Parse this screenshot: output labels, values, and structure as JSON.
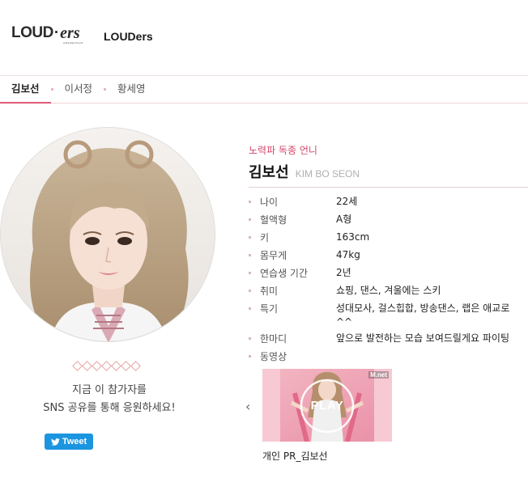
{
  "header": {
    "logo_main": "LOUD",
    "logo_dot": "·",
    "logo_ers": "ers",
    "logo_sub": "entertainment",
    "company_name": "LOUDers"
  },
  "tabs": [
    {
      "label": "김보선",
      "active": true
    },
    {
      "label": "이서정",
      "active": false
    },
    {
      "label": "황세영",
      "active": false
    }
  ],
  "profile": {
    "catchphrase": "노력파 독종 언니",
    "name_kr": "김보선",
    "name_en": "KIM BO SEON",
    "details": [
      {
        "label": "나이",
        "value": "22세"
      },
      {
        "label": "혈액형",
        "value": "A형"
      },
      {
        "label": "키",
        "value": "163cm"
      },
      {
        "label": "몸무게",
        "value": "47kg"
      },
      {
        "label": "연습생 기간",
        "value": "2년"
      },
      {
        "label": "취미",
        "value": "쇼핑, 댄스, 겨울에는 스키"
      },
      {
        "label": "특기",
        "value": "성대모사, 걸스힙합, 방송댄스, 랩은 애교로 ^^"
      },
      {
        "label": "한마디",
        "value": "앞으로 발전하는 모습 보여드릴게요 파이팅"
      },
      {
        "label": "동영상",
        "value": ""
      }
    ]
  },
  "support": {
    "line1": "지금 이 참가자를",
    "line2": "SNS 공유를 통해 응원하세요!",
    "tweet_label": "Tweet"
  },
  "video": {
    "prev_icon": "chevron-left-icon",
    "play_label": "PLAY",
    "badge": "M.net",
    "caption": "개인 PR_김보선"
  },
  "colors": {
    "accent": "#d6476a",
    "tweet": "#1b95e0"
  }
}
